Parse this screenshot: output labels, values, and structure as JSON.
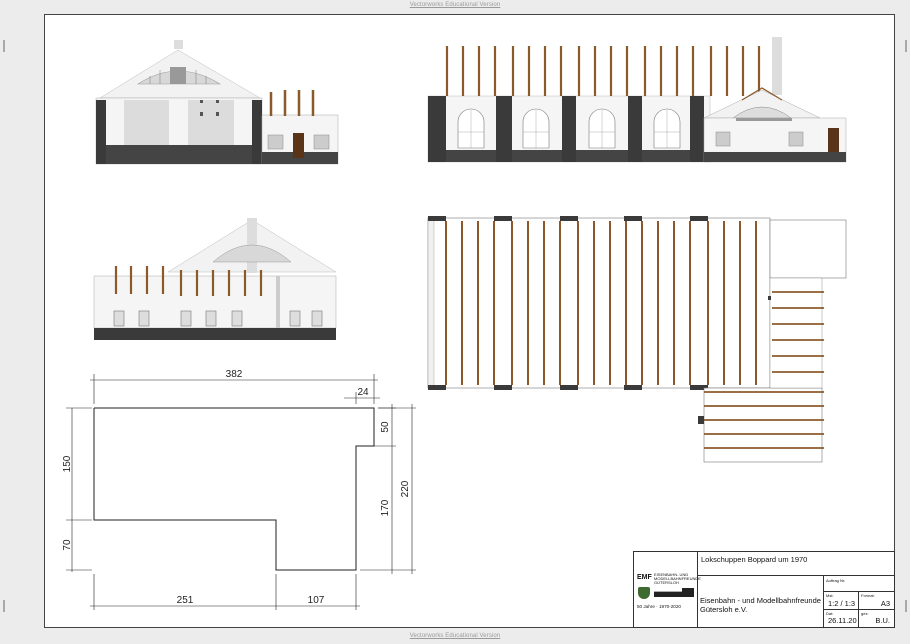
{
  "watermark": {
    "top": "Vectorworks Educational Version",
    "bottom": "Vectorworks Educational Version"
  },
  "dimensions": {
    "top_width": "382",
    "notch_width": "24",
    "left_upper": "150",
    "left_lower": "70",
    "right_notch": "50",
    "right_mid": "170",
    "right_total": "220",
    "bottom_left": "251",
    "bottom_right": "107"
  },
  "titleblock": {
    "title": "Lokschuppen Boppard um 1970",
    "logo_text": "EMF",
    "logo_small_1": "EISENBAHN- UND",
    "logo_small_2": "MODELLBAHNFREUNDE",
    "logo_small_3": "GÜTERSLOH",
    "anniversary": "50 Jahre  ·  1970-2020",
    "org_line1": "Eisenbahn - und Modellbahnfreunde",
    "org_line2": "Gütersloh e.V.",
    "auftrag_label": "Auftrag Nr:",
    "mst_label": "Mst:",
    "mst_value": "1:2 / 1:3",
    "format_label": "Format:",
    "format_value": "A3",
    "dat_label": "Dat:",
    "dat_value": "26.11.20",
    "gez_label": "gez:",
    "gez_value": "B.U."
  },
  "colors": {
    "wall_dark": "#3a3a3a",
    "beam": "#8b5a2b",
    "wall_light": "#efefef"
  }
}
